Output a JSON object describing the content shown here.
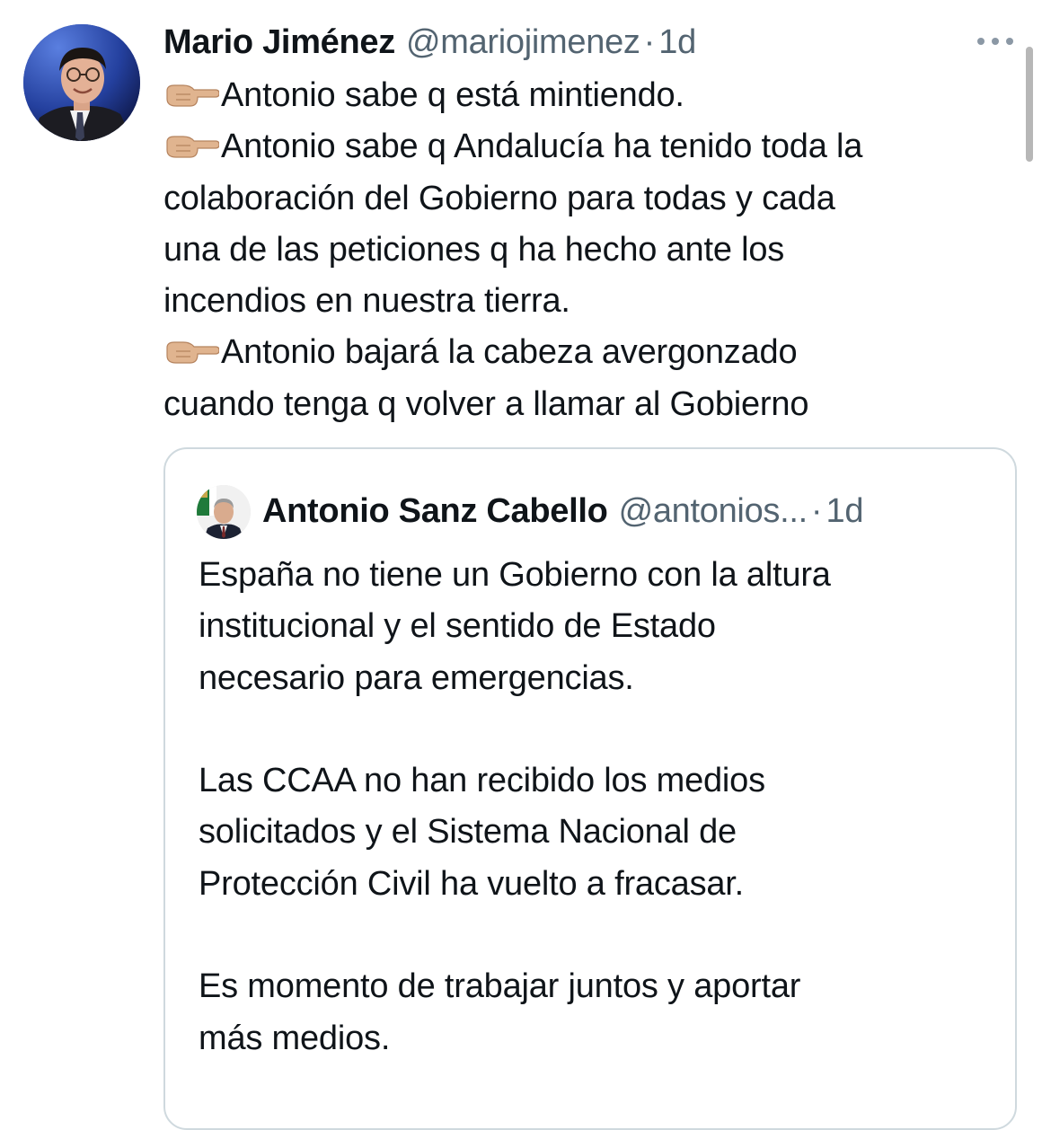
{
  "tweet": {
    "author": {
      "display_name": "Mario Jiménez",
      "handle": "@mariojimenez",
      "avatar_icon": "profile-photo"
    },
    "separator": "·",
    "timestamp": "1d",
    "more_icon": "more-horizontal-icon",
    "emoji": "👉🏼",
    "lines": [
      "Antonio sabe q está mintiendo.",
      "Antonio sabe q Andalucía ha tenido toda la",
      "colaboración del Gobierno para todas y cada",
      "una de las peticiones q ha hecho ante los",
      "incendios en nuestra tierra.",
      "Antonio bajará la cabeza avergonzado",
      "cuando tenga q volver a llamar al Gobierno"
    ]
  },
  "quoted_tweet": {
    "author": {
      "display_name": "Antonio Sanz Cabello",
      "handle": "@antonios...",
      "avatar_icon": "profile-photo"
    },
    "separator": "·",
    "timestamp": "1d",
    "lines": [
      "España no tiene un Gobierno con la altura",
      "institucional y el sentido de Estado",
      "necesario para emergencias.",
      "",
      "Las CCAA no han recibido los medios",
      "solicitados y el Sistema Nacional de",
      "Protección Civil ha vuelto a fracasar.",
      "",
      "Es momento de trabajar juntos y aportar",
      "más medios."
    ]
  },
  "colors": {
    "text": "#0f1419",
    "secondary": "#536471",
    "border": "#cfd9de"
  }
}
